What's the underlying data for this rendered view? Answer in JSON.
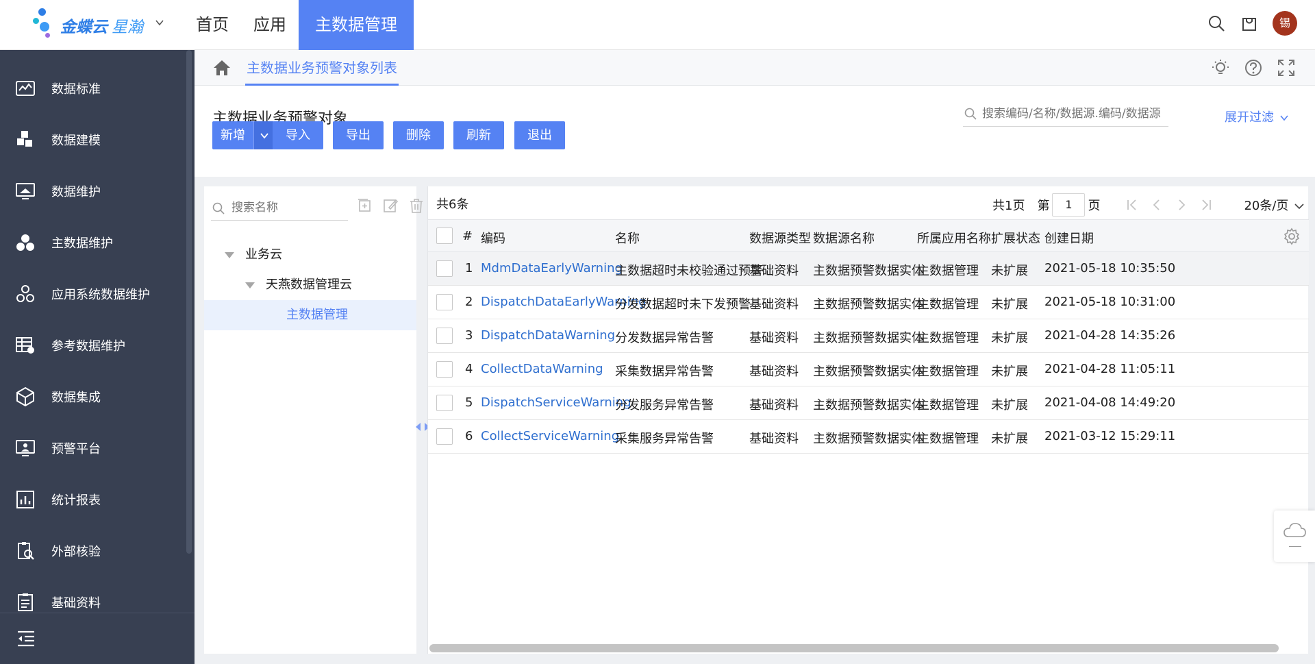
{
  "app": {
    "brand_name": "金蝶云",
    "brand_sub": "星瀚",
    "top_nav": [
      "首页",
      "应用",
      "主数据管理"
    ],
    "active_nav": "主数据管理",
    "avatar_text": "锡"
  },
  "sidebar": {
    "items": [
      {
        "label": "数据标准",
        "icon": "data-standard-icon"
      },
      {
        "label": "数据建模",
        "icon": "data-modeling-icon"
      },
      {
        "label": "数据维护",
        "icon": "data-maintenance-icon"
      },
      {
        "label": "主数据维护",
        "icon": "master-data-icon"
      },
      {
        "label": "应用系统数据维护",
        "icon": "app-system-icon"
      },
      {
        "label": "参考数据维护",
        "icon": "reference-data-icon"
      },
      {
        "label": "数据集成",
        "icon": "data-integration-icon"
      },
      {
        "label": "预警平台",
        "icon": "warning-platform-icon"
      },
      {
        "label": "统计报表",
        "icon": "report-icon"
      },
      {
        "label": "外部核验",
        "icon": "external-check-icon"
      },
      {
        "label": "基础资料",
        "icon": "basic-data-icon"
      }
    ]
  },
  "tabbar": {
    "active_tab": "主数据业务预警对象列表"
  },
  "page": {
    "title": "主数据业务预警对象",
    "search_placeholder": "搜索编码/名称/数据源.编码/数据源",
    "expand_filter": "展开过滤"
  },
  "toolbar": {
    "add": "新增",
    "import": "导入",
    "export": "导出",
    "delete": "删除",
    "refresh": "刷新",
    "exit": "退出"
  },
  "tree": {
    "search_placeholder": "搜索名称",
    "nodes": [
      {
        "label": "业务云",
        "level": 0,
        "expanded": true
      },
      {
        "label": "天燕数据管理云",
        "level": 1,
        "expanded": true
      },
      {
        "label": "主数据管理",
        "level": 2,
        "selected": true
      }
    ]
  },
  "table": {
    "total": "共6条",
    "pager": {
      "pages_total": "共1页",
      "page_prefix": "第",
      "page_current": "1",
      "page_suffix": "页",
      "page_size": "20条/页"
    },
    "columns": [
      "#",
      "编码",
      "名称",
      "数据源类型",
      "数据源名称",
      "所属应用名称",
      "扩展状态",
      "创建日期"
    ],
    "rows": [
      {
        "no": "1",
        "code": "MdmDataEarlyWarning",
        "name": "主数据超时未校验通过预警",
        "source_type": "基础资料",
        "source_name": "主数据预警数据实体",
        "app_name": "主数据管理",
        "ext_status": "未扩展",
        "created": "2021-05-18 10:35:50"
      },
      {
        "no": "2",
        "code": "DispatchDataEarlyWarning",
        "name": "分发数据超时未下发预警",
        "source_type": "基础资料",
        "source_name": "主数据预警数据实体",
        "app_name": "主数据管理",
        "ext_status": "未扩展",
        "created": "2021-05-18 10:31:00"
      },
      {
        "no": "3",
        "code": "DispatchDataWarning",
        "name": "分发数据异常告警",
        "source_type": "基础资料",
        "source_name": "主数据预警数据实体",
        "app_name": "主数据管理",
        "ext_status": "未扩展",
        "created": "2021-04-28 14:35:26"
      },
      {
        "no": "4",
        "code": "CollectDataWarning",
        "name": "采集数据异常告警",
        "source_type": "基础资料",
        "source_name": "主数据预警数据实体",
        "app_name": "主数据管理",
        "ext_status": "未扩展",
        "created": "2021-04-28 11:05:11"
      },
      {
        "no": "5",
        "code": "DispatchServiceWarning",
        "name": "分发服务异常告警",
        "source_type": "基础资料",
        "source_name": "主数据预警数据实体",
        "app_name": "主数据管理",
        "ext_status": "未扩展",
        "created": "2021-04-08 14:49:20"
      },
      {
        "no": "6",
        "code": "CollectServiceWarning",
        "name": "采集服务异常告警",
        "source_type": "基础资料",
        "source_name": "主数据预警数据实体",
        "app_name": "主数据管理",
        "ext_status": "未扩展",
        "created": "2021-03-12 15:29:11"
      }
    ]
  },
  "colors": {
    "accent": "#5582f3",
    "sidebar_bg": "#384052",
    "link": "#2f6fcf",
    "avatar_bg": "#a3341d"
  }
}
